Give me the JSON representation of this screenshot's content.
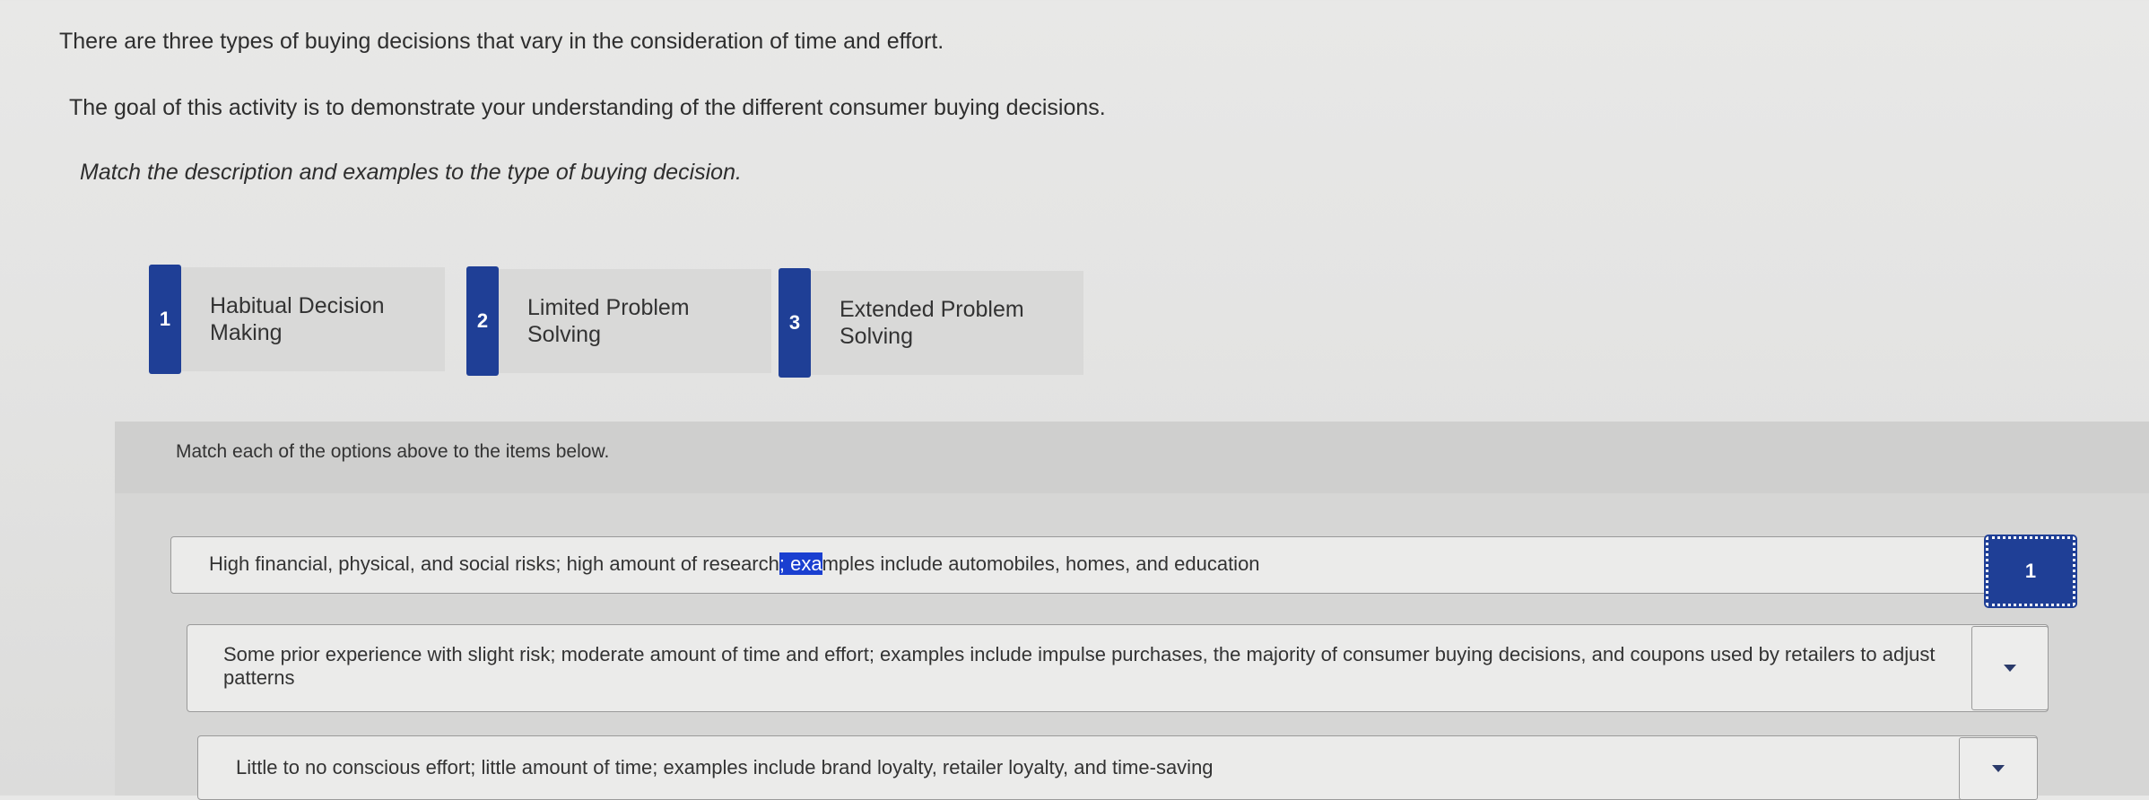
{
  "intro": {
    "line1": "There are three types of buying decisions that vary in the consideration of time and effort.",
    "line2": "The goal of this activity is to demonstrate your understanding of the different consumer buying decisions.",
    "line3": "Match the description and examples to the type of buying decision."
  },
  "options": [
    {
      "number": "1",
      "label": "Habitual Decision Making"
    },
    {
      "number": "2",
      "label": "Limited Problem Solving"
    },
    {
      "number": "3",
      "label": "Extended Problem Solving"
    }
  ],
  "match": {
    "instruction": "Match each of the options above to the items below.",
    "items": [
      {
        "desc_before": "High financial, physical, and social risks; high amount of research",
        "desc_highlight": "; exa",
        "desc_after": "mples include automobiles, homes, and education",
        "selected": "1"
      },
      {
        "desc": "Some prior experience with slight risk; moderate amount of time and effort; examples include impulse purchases, the majority of consumer buying decisions, and coupons used by retailers to adjust patterns",
        "selected": ""
      },
      {
        "desc": "Little to no conscious effort; little amount of time; examples include brand loyalty, retailer loyalty, and time-saving",
        "selected": ""
      }
    ]
  },
  "colors": {
    "accent": "#1f3f96",
    "highlight": "#1a3fd0"
  },
  "icons": {
    "dropdown": "chevron-down-icon"
  }
}
